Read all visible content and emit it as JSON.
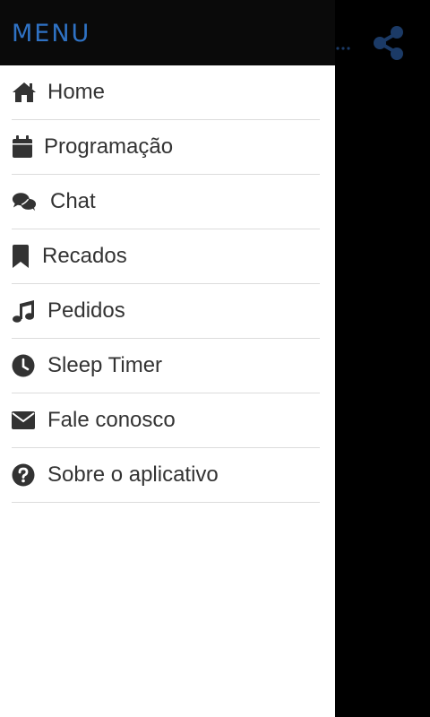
{
  "drawer": {
    "title": "MENU",
    "items": [
      {
        "label": "Home",
        "icon": "home-icon"
      },
      {
        "label": "Programação",
        "icon": "calendar-icon"
      },
      {
        "label": "Chat",
        "icon": "chat-bubbles-icon"
      },
      {
        "label": "Recados",
        "icon": "bookmark-icon"
      },
      {
        "label": "Pedidos",
        "icon": "music-note-icon"
      },
      {
        "label": "Sleep Timer",
        "icon": "clock-icon"
      },
      {
        "label": "Fale conosco",
        "icon": "envelope-icon"
      },
      {
        "label": "Sobre o aplicativo",
        "icon": "question-circle-icon"
      }
    ]
  },
  "colors": {
    "header_bg": "#0a0a0a",
    "title": "#2f72c4",
    "icon": "#333333",
    "share_icon": "#1b3a66",
    "divider": "#dcdcdc"
  },
  "background": {
    "share_icon": "share-icon",
    "overflow_icon": "more-dots-icon"
  }
}
